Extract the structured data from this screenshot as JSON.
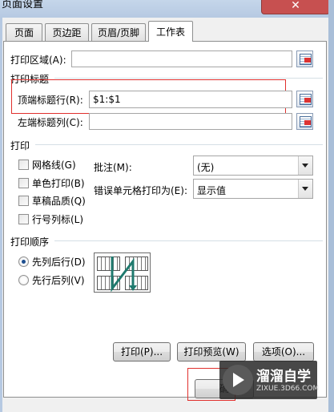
{
  "window": {
    "title": "页面设置",
    "close_label": "✕"
  },
  "tabs": [
    {
      "label": "页面"
    },
    {
      "label": "页边距"
    },
    {
      "label": "页眉/页脚"
    },
    {
      "label": "工作表"
    }
  ],
  "print_area": {
    "label": "打印区域(A):",
    "value": ""
  },
  "print_titles": {
    "group_label": "打印标题",
    "rows": {
      "label": "顶端标题行(R):",
      "value": "$1:$1"
    },
    "columns": {
      "label": "左端标题列(C):",
      "value": ""
    }
  },
  "print": {
    "group_label": "打印",
    "checkboxes": [
      {
        "label": "网格线(G)",
        "checked": false
      },
      {
        "label": "单色打印(B)",
        "checked": false
      },
      {
        "label": "草稿品质(Q)",
        "checked": false
      },
      {
        "label": "行号列标(L)",
        "checked": false
      }
    ],
    "comments": {
      "label": "批注(M):",
      "value": "(无)"
    },
    "errors": {
      "label": "错误单元格打印为(E):",
      "value": "显示值"
    }
  },
  "order": {
    "group_label": "打印顺序",
    "options": [
      {
        "label": "先列后行(D)",
        "selected": true
      },
      {
        "label": "先行后列(V)",
        "selected": false
      }
    ]
  },
  "buttons": {
    "print": "打印(P)...",
    "preview": "打印预览(W)",
    "options": "选项(O)...",
    "ok": "确"
  },
  "watermark": {
    "title": "溜溜自学",
    "url": "ZIXUE.3D66.COM"
  },
  "colors": {
    "highlight_red": "#e0302d",
    "titlebar": "#b6c9e2"
  }
}
